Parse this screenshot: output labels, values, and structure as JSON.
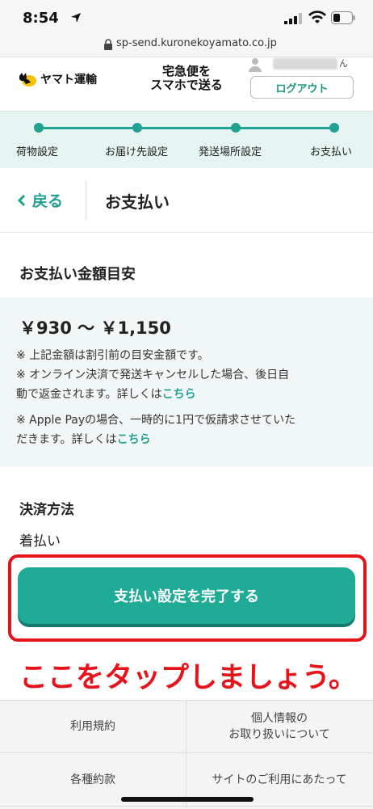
{
  "status": {
    "time": "8:54",
    "url": "sp-send.kuronekoyamato.co.jp"
  },
  "header": {
    "logo_text": "ヤマト運輸",
    "service_title_line1": "宅急便を",
    "service_title_line2": "スマホで送る",
    "user_suffix": "ん",
    "logout_label": "ログアウト"
  },
  "steps": [
    {
      "label": "荷物設定"
    },
    {
      "label": "お届け先設定"
    },
    {
      "label": "発送場所設定"
    },
    {
      "label": "お支払い"
    }
  ],
  "nav": {
    "back_label": "戻る",
    "page_title": "お支払い"
  },
  "payment_estimate": {
    "title": "お支払い金額目安",
    "amount": "￥930 〜 ￥1,150",
    "notes": [
      {
        "text": "※ 上記金額は割引前の目安金額です。",
        "link": ""
      },
      {
        "text_line1": "※ オンライン決済で発送キャンセルした場合、後日自",
        "text_line2": "動で返金されます。詳しくは",
        "link": "こちら"
      },
      {
        "text_line1": "※ Apple Payの場合、一時的に1円で仮請求させていた",
        "text_line2": "だきます。詳しくは",
        "link": "こちら"
      }
    ]
  },
  "payment_method": {
    "label": "決済方法",
    "value": "着払い"
  },
  "complete_button_label": "支払い設定を完了する",
  "annotation_text": "ここをタップしましょう。",
  "footer": {
    "terms": "利用規約",
    "privacy_line1": "個人情報の",
    "privacy_line2": "お取り扱いについて",
    "agreements": "各種約款",
    "site_usage": "サイトのご利用にあたって"
  },
  "colors": {
    "accent": "#21a191",
    "button": "#1fab96",
    "highlight": "#e6141a"
  }
}
